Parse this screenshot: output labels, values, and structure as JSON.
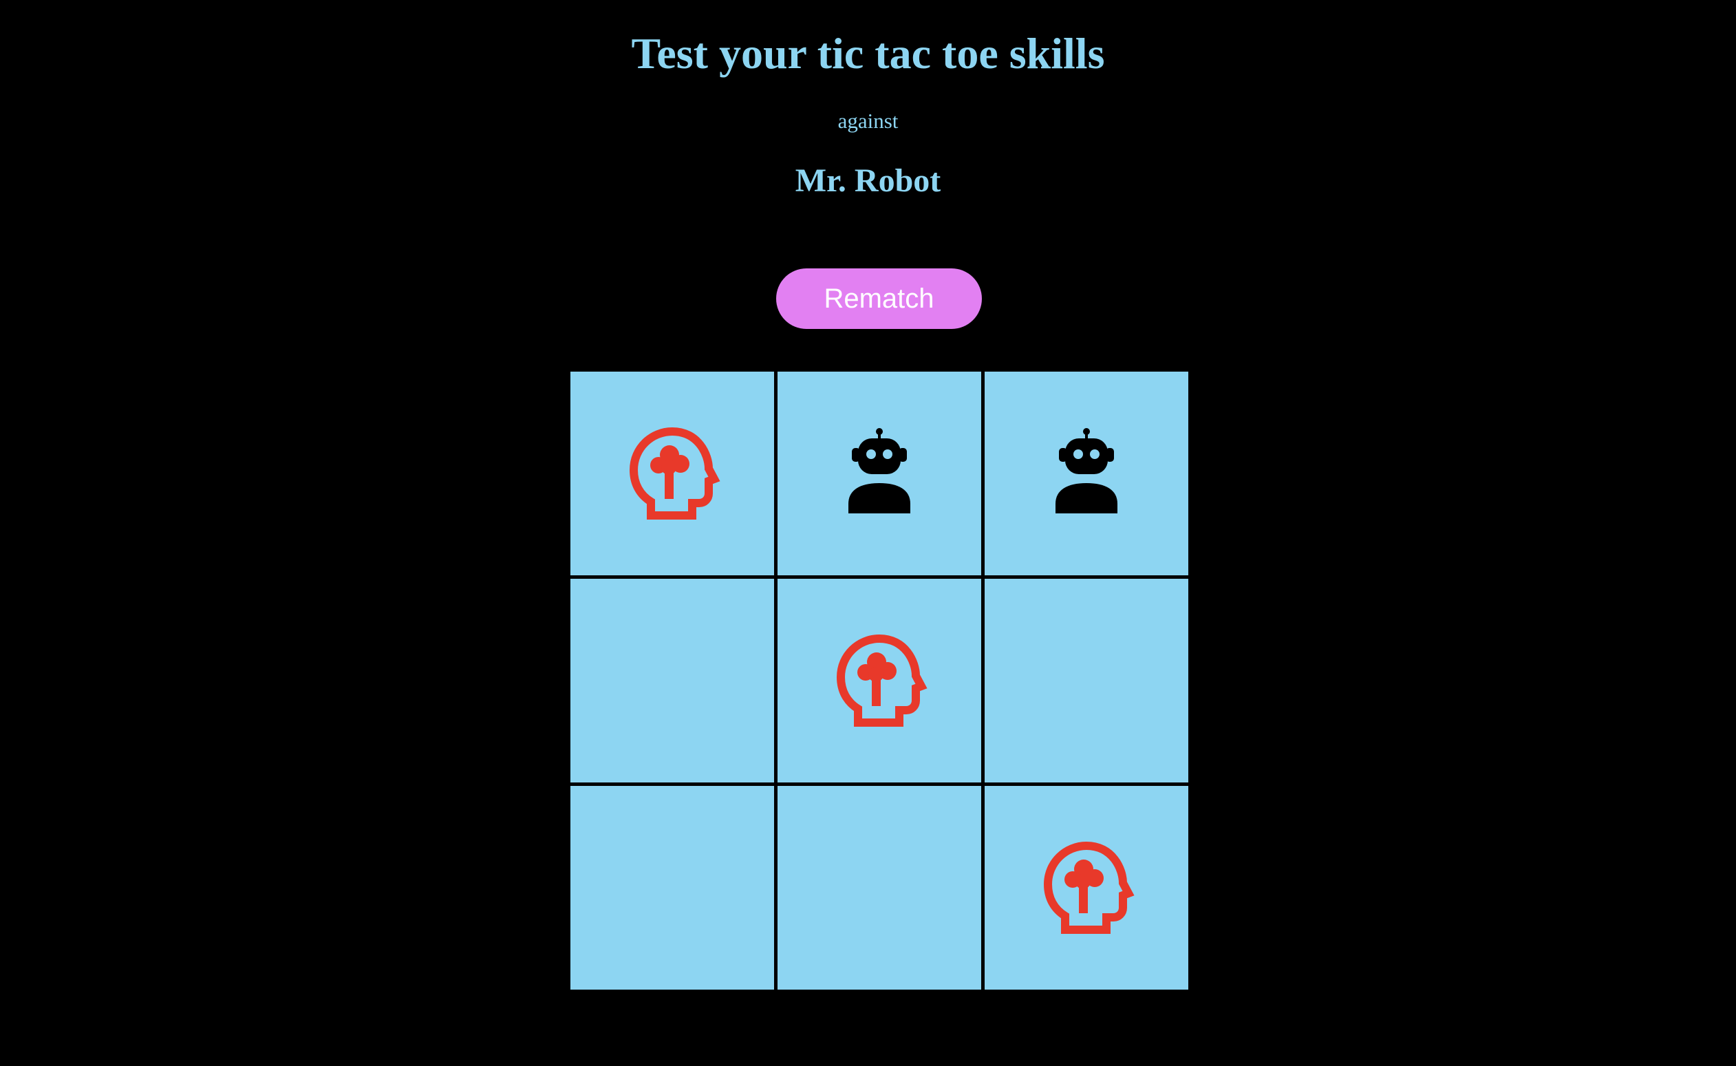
{
  "header": {
    "title": "Test your tic tac toe skills",
    "subtitle": "against",
    "opponent": "Mr. Robot"
  },
  "controls": {
    "rematch_label": "Rematch"
  },
  "colors": {
    "background": "#000000",
    "accent_text": "#8dd5f2",
    "board_cell": "#8dd5f2",
    "button": "#e280f2",
    "human_mark": "#e8392a",
    "robot_mark": "#000000"
  },
  "board": {
    "cells": [
      {
        "mark": "human",
        "icon": "human-head-icon"
      },
      {
        "mark": "robot",
        "icon": "robot-icon"
      },
      {
        "mark": "robot",
        "icon": "robot-icon"
      },
      {
        "mark": "",
        "icon": ""
      },
      {
        "mark": "human",
        "icon": "human-head-icon"
      },
      {
        "mark": "",
        "icon": ""
      },
      {
        "mark": "",
        "icon": ""
      },
      {
        "mark": "",
        "icon": ""
      },
      {
        "mark": "human",
        "icon": "human-head-icon"
      }
    ]
  }
}
